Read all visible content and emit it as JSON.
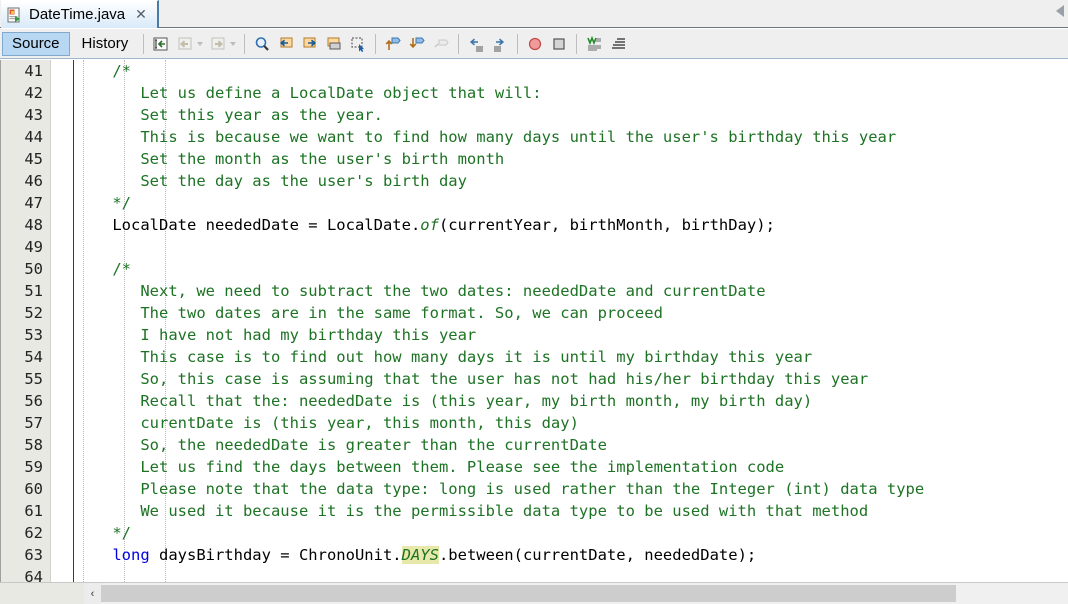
{
  "window": {
    "tab": {
      "title": "DateTime.java",
      "icon": "java-file-icon",
      "close_label": "✕",
      "overflow_icon": "tab-overflow-icon"
    }
  },
  "toolbar": {
    "view_tabs": [
      {
        "label": "Source",
        "selected": true
      },
      {
        "label": "History",
        "selected": false
      }
    ],
    "buttons": [
      {
        "name": "last-edit-icon",
        "group": 0,
        "disabled": false
      },
      {
        "name": "back-icon",
        "group": 0,
        "disabled": true
      },
      {
        "name": "back-dropdown-icon",
        "group": 0,
        "disabled": true,
        "caret": true
      },
      {
        "name": "forward-icon",
        "group": 0,
        "disabled": true
      },
      {
        "name": "forward-dropdown-icon",
        "group": 0,
        "disabled": true,
        "caret": true
      },
      {
        "name": "find-selection-icon",
        "group": 1,
        "disabled": false
      },
      {
        "name": "find-previous-icon",
        "group": 1,
        "disabled": false
      },
      {
        "name": "find-next-icon",
        "group": 1,
        "disabled": false
      },
      {
        "name": "toggle-highlight-icon",
        "group": 1,
        "disabled": false
      },
      {
        "name": "toggle-rectangular-selection-icon",
        "group": 1,
        "disabled": false
      },
      {
        "name": "previous-bookmark-icon",
        "group": 2,
        "disabled": false
      },
      {
        "name": "next-bookmark-icon",
        "group": 2,
        "disabled": false
      },
      {
        "name": "toggle-bookmark-icon",
        "group": 2,
        "disabled": true
      },
      {
        "name": "shift-line-left-icon",
        "group": 3,
        "disabled": false
      },
      {
        "name": "shift-line-right-icon",
        "group": 3,
        "disabled": false
      },
      {
        "name": "start-macro-recording-icon",
        "group": 4,
        "disabled": false
      },
      {
        "name": "stop-macro-recording-icon",
        "group": 4,
        "disabled": false
      },
      {
        "name": "comment-icon",
        "group": 5,
        "disabled": false
      },
      {
        "name": "uncomment-icon",
        "group": 5,
        "disabled": false
      }
    ]
  },
  "editor": {
    "first_line": 41,
    "colors": {
      "comment": "#1d7324",
      "keyword": "#0000e6",
      "plain": "#000000",
      "highlight": "#e8e8aa",
      "gutter_bg": "#e9e9e4",
      "editor_bg": "#ffffff"
    },
    "lines": [
      {
        "n": 41,
        "tokens": [
          {
            "t": "    /*",
            "c": "cmt"
          }
        ]
      },
      {
        "n": 42,
        "tokens": [
          {
            "t": "       Let us define a LocalDate object that will:",
            "c": "cmt"
          }
        ]
      },
      {
        "n": 43,
        "tokens": [
          {
            "t": "       Set this year as the year.",
            "c": "cmt"
          }
        ]
      },
      {
        "n": 44,
        "tokens": [
          {
            "t": "       This is because we want to find how many days until the user's birthday this year",
            "c": "cmt"
          }
        ]
      },
      {
        "n": 45,
        "tokens": [
          {
            "t": "       Set the month as the user's birth month",
            "c": "cmt"
          }
        ]
      },
      {
        "n": 46,
        "tokens": [
          {
            "t": "       Set the day as the user's birth day",
            "c": "cmt"
          }
        ]
      },
      {
        "n": 47,
        "tokens": [
          {
            "t": "    */",
            "c": "cmt"
          }
        ]
      },
      {
        "n": 48,
        "tokens": [
          {
            "t": "    LocalDate neededDate = LocalDate.",
            "c": "pln"
          },
          {
            "t": "of",
            "c": "sm"
          },
          {
            "t": "(currentYear, birthMonth, birthDay);",
            "c": "pln"
          }
        ]
      },
      {
        "n": 49,
        "tokens": [
          {
            "t": "",
            "c": "pln"
          }
        ]
      },
      {
        "n": 50,
        "tokens": [
          {
            "t": "    /*",
            "c": "cmt"
          }
        ]
      },
      {
        "n": 51,
        "tokens": [
          {
            "t": "       Next, we need to subtract the two dates: neededDate and currentDate",
            "c": "cmt"
          }
        ]
      },
      {
        "n": 52,
        "tokens": [
          {
            "t": "       The two dates are in the same format. So, we can proceed",
            "c": "cmt"
          }
        ]
      },
      {
        "n": 53,
        "tokens": [
          {
            "t": "       I have not had my birthday this year",
            "c": "cmt"
          }
        ]
      },
      {
        "n": 54,
        "tokens": [
          {
            "t": "       This case is to find out how many days it is until my birthday this year",
            "c": "cmt"
          }
        ]
      },
      {
        "n": 55,
        "tokens": [
          {
            "t": "       So, this case is assuming that the user has not had his/her birthday this year",
            "c": "cmt"
          }
        ]
      },
      {
        "n": 56,
        "tokens": [
          {
            "t": "       Recall that the: neededDate is (this year, my birth month, my birth day)",
            "c": "cmt"
          }
        ]
      },
      {
        "n": 57,
        "tokens": [
          {
            "t": "       curentDate is (this year, this month, this day)",
            "c": "cmt"
          }
        ]
      },
      {
        "n": 58,
        "tokens": [
          {
            "t": "       So, the neededDate is greater than the currentDate",
            "c": "cmt"
          }
        ]
      },
      {
        "n": 59,
        "tokens": [
          {
            "t": "       Let us find the days between them. Please see the implementation code",
            "c": "cmt"
          }
        ]
      },
      {
        "n": 60,
        "tokens": [
          {
            "t": "       Please note that the data type: long is used rather than the Integer (int) data type",
            "c": "cmt"
          }
        ]
      },
      {
        "n": 61,
        "tokens": [
          {
            "t": "       We used it because it is the permissible data type to be used with that method",
            "c": "cmt"
          }
        ]
      },
      {
        "n": 62,
        "tokens": [
          {
            "t": "    */",
            "c": "cmt"
          }
        ]
      },
      {
        "n": 63,
        "tokens": [
          {
            "t": "    ",
            "c": "pln"
          },
          {
            "t": "long",
            "c": "kw"
          },
          {
            "t": " daysBirthday = ChronoUnit.",
            "c": "pln"
          },
          {
            "t": "DAYS",
            "c": "sm hl"
          },
          {
            "t": ".between(currentDate, neededDate);",
            "c": "pln"
          }
        ]
      },
      {
        "n": 64,
        "tokens": [
          {
            "t": "",
            "c": "pln"
          }
        ]
      }
    ]
  },
  "scrollbar": {
    "left_arrow": "‹",
    "thumb_name": "horizontal-scroll-thumb"
  }
}
